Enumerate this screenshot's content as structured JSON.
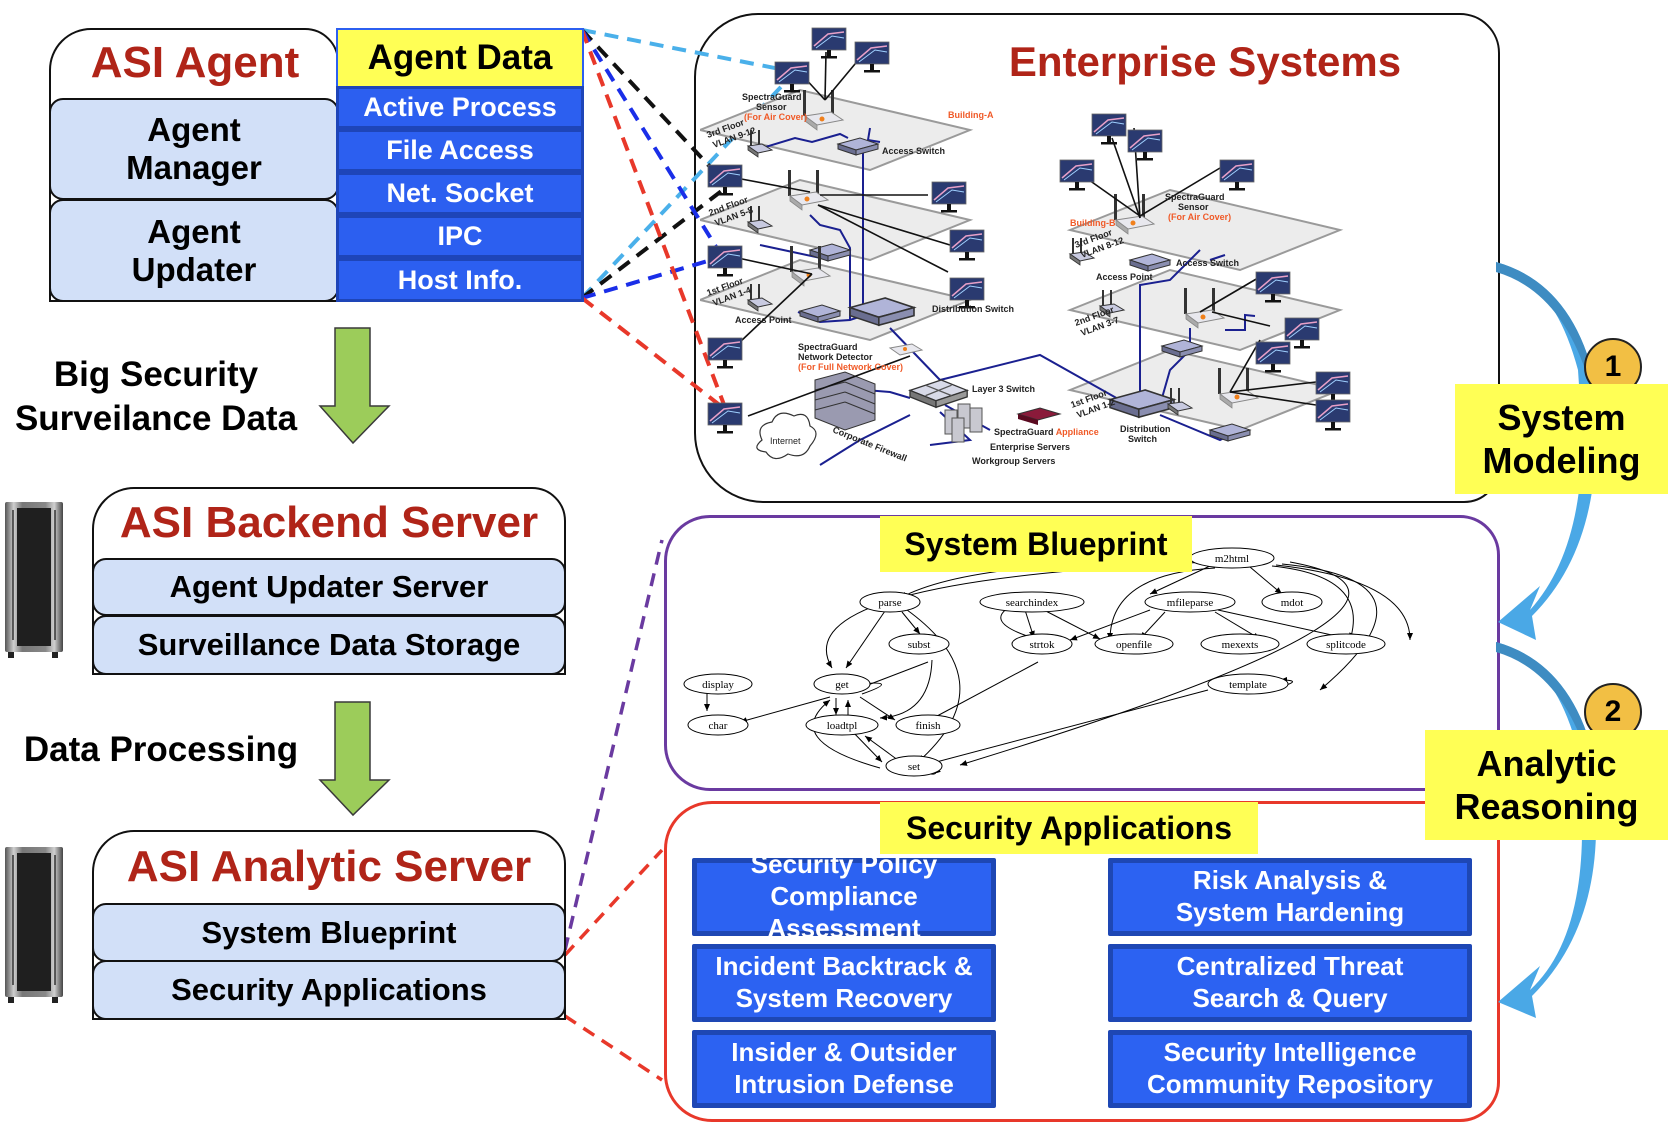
{
  "agent": {
    "title": "ASI Agent",
    "modules": [
      "Agent Manager",
      "Agent Updater"
    ],
    "data_header": "Agent Data",
    "data_items": [
      "Active Process",
      "File Access",
      "Net. Socket",
      "IPC",
      "Host Info."
    ]
  },
  "flow": {
    "arrow1_label_line1": "Big Security",
    "arrow1_label_line2": "Surveilance Data",
    "arrow2_label": "Data Processing"
  },
  "backend": {
    "title": "ASI Backend Server",
    "modules": [
      "Agent Updater Server",
      "Surveillance Data Storage"
    ]
  },
  "analytic": {
    "title": "ASI Analytic Server",
    "modules": [
      "System Blueprint",
      "Security Applications"
    ]
  },
  "enterprise": {
    "title": "Enterprise Systems",
    "labels": {
      "building_a": "Building-A",
      "building_b": "Building-B",
      "sensor_a_line1": "SpectraGuard",
      "sensor_a_line2": "Sensor",
      "sensor_a_line3": "(For Air Cover)",
      "sensor_b_line1": "SpectraGuard",
      "sensor_b_line2": "Sensor",
      "sensor_b_line3": "(For Air Cover)",
      "floor_a3": "3rd Floor",
      "vlan_a3": "VLAN 9-12",
      "floor_a2": "2nd Floor",
      "vlan_a2": "VLAN 5-8",
      "floor_a1": "1st Floor",
      "vlan_a1": "VLAN 1-4",
      "floor_b3": "3rd Floor",
      "vlan_b3": "VLAN 8-12",
      "floor_b2": "2nd Floor",
      "vlan_b2": "VLAN 3-7",
      "floor_b1": "1st Floor",
      "vlan_b1": "VLAN 1-2",
      "access_switch_a": "Access Switch",
      "access_switch_b": "Access Switch",
      "access_point_a": "Access Point",
      "access_point_b": "Access Point",
      "distribution_switch_a": "Distribution Switch",
      "distribution_switch_b_line1": "Distribution",
      "distribution_switch_b_line2": "Switch",
      "detector_line1": "SpectraGuard",
      "detector_line2": "Network Detector",
      "detector_line3": "(For Full Network Cover)",
      "layer3_switch": "Layer 3 Switch",
      "appliance_a": "SpectraGuard ",
      "appliance_b": "Appliance",
      "enterprise_servers": "Enterprise Servers",
      "workgroup_servers": "Workgroup Servers",
      "firewall": "Corporate Firewall",
      "internet": "Internet"
    }
  },
  "blueprint": {
    "title": "System Blueprint",
    "nodes": [
      "m2html",
      "parse",
      "searchindex",
      "mfileparse",
      "mdot",
      "subst",
      "strtok",
      "openfile",
      "mexexts",
      "splitcode",
      "display",
      "get",
      "template",
      "char",
      "loadtpl",
      "finish",
      "set"
    ]
  },
  "applications": {
    "title": "Security Applications",
    "items": [
      {
        "line1": "Security Policy",
        "line2": "Compliance Assessment"
      },
      {
        "line1": "Risk Analysis &",
        "line2": "System Hardening"
      },
      {
        "line1": "Incident Backtrack &",
        "line2": "System Recovery"
      },
      {
        "line1": "Centralized Threat",
        "line2": "Search & Query"
      },
      {
        "line1": "Insider & Outsider",
        "line2": "Intrusion Defense"
      },
      {
        "line1": "Security Intelligence",
        "line2": "Community Repository"
      }
    ]
  },
  "steps": [
    {
      "number": "1",
      "line1": "System",
      "line2": "Modeling"
    },
    {
      "number": "2",
      "line1": "Analytic",
      "line2": "Reasoning"
    }
  ],
  "colors": {
    "title_red": "#b02418",
    "data_blue": "#2c5ff0",
    "highlight_yellow": "#ffff55",
    "module_fill": "#d2e0f8",
    "arrow_green": "#9ccc5a",
    "step_arrow_blue": "#4aa8e6",
    "badge_orange": "#f2bf44",
    "blueprint_border": "#6a3aa0",
    "apps_border": "#e8382a"
  }
}
